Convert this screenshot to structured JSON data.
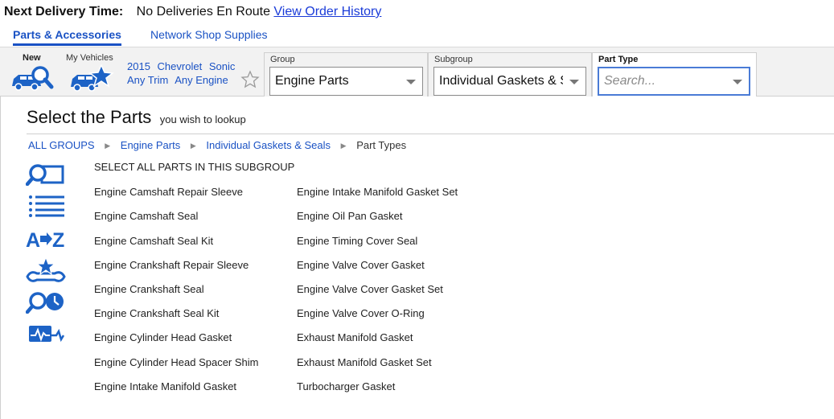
{
  "delivery": {
    "label": "Next Delivery Time:",
    "status": "No Deliveries En Route",
    "history_link": "View Order History"
  },
  "tabs": [
    {
      "label": "Parts & Accessories",
      "active": true
    },
    {
      "label": "Network Shop Supplies",
      "active": false
    }
  ],
  "toolbar": {
    "new_label": "New",
    "my_vehicles_label": "My Vehicles",
    "vehicle": {
      "year": "2015",
      "make": "Chevrolet",
      "model": "Sonic",
      "trim": "Any Trim",
      "engine": "Any Engine"
    },
    "group": {
      "caption": "Group",
      "value": "Engine Parts"
    },
    "subgroup": {
      "caption": "Subgroup",
      "value": "Individual Gaskets & Seals"
    },
    "part_type": {
      "caption": "Part Type",
      "placeholder": "Search..."
    }
  },
  "main": {
    "title": "Select the Parts",
    "subtitle": "you wish to lookup",
    "breadcrumb": [
      "ALL GROUPS",
      "Engine Parts",
      "Individual Gaskets & Seals",
      "Part Types"
    ],
    "select_all": "SELECT ALL PARTS IN THIS SUBGROUP",
    "parts_col1": [
      "Engine Camshaft Repair Sleeve",
      "Engine Camshaft Seal",
      "Engine Camshaft Seal Kit",
      "Engine Crankshaft Repair Sleeve",
      "Engine Crankshaft Seal",
      "Engine Crankshaft Seal Kit",
      "Engine Cylinder Head Gasket",
      "Engine Cylinder Head Spacer Shim",
      "Engine Intake Manifold Gasket"
    ],
    "parts_col2": [
      "Engine Intake Manifold Gasket Set",
      "Engine Oil Pan Gasket",
      "Engine Timing Cover Seal",
      "Engine Valve Cover Gasket",
      "Engine Valve Cover Gasket Set",
      "Engine Valve Cover O-Ring",
      "Exhaust Manifold Gasket",
      "Exhaust Manifold Gasket Set",
      "Turbocharger Gasket"
    ]
  },
  "icons": {
    "new_vehicle": "car-search-icon",
    "my_vehicles": "car-star-icon",
    "favorite": "star-outline-icon",
    "sidebar": [
      "search-catalog-icon",
      "list-view-icon",
      "a-to-z-icon",
      "tools-star-icon",
      "search-clock-icon",
      "diagnostic-icon"
    ]
  },
  "colors": {
    "link": "#1a52c4",
    "icon_blue": "#1d63c6",
    "toolbar_bg": "#f2f2f2"
  }
}
